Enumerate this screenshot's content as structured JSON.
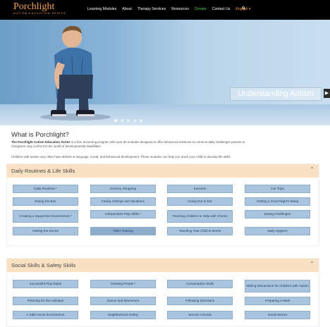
{
  "nav": {
    "logo": "Porchlight",
    "logo_sub": "AUTISM EDUCATION SERIES",
    "items": [
      "Learning Modules",
      "About",
      "Therapy Services",
      "Resources",
      "Donate",
      "Contact Us",
      "English ▾"
    ]
  },
  "hero": {
    "caption": "Understanding Autism",
    "next_glyph": "▶"
  },
  "intro": {
    "title": "What is Porchlight?",
    "bold": "The Porchlight Autism Education Series",
    "text": " is a free eLearning program with over 60 modules designed to offer behavioral solutions to common daily challenges parents or caregivers may confront in the world of developmental disabilities.",
    "text2": "Children with autism very often have deficits in language, social, and behavioral development. These modules can help you teach your child to develop life skills."
  },
  "sections": [
    {
      "title": "Daily Routines & Life Skills",
      "caret": "⌃",
      "buttons": [
        "Daily Routines *",
        "Grocery Shopping",
        "Exercise",
        "Car Trips",
        "Riding the Bus",
        "Family Outings and Vacations",
        "Going Out to Eat",
        "Getting a Good Night's Sleep",
        "Creating a Supportive Environment *",
        "Independent Play Skills *",
        "Teaching Children to Help with Chores",
        "Eating Challenges",
        "Visiting the Doctor",
        "Toilet Training",
        "Teaching Your Child to Dress",
        "Daily Hygiene"
      ]
    },
    {
      "title": "Social Skills & Safety Skills",
      "caret": "⌃",
      "buttons": [
        "Successful Play Dates",
        "Greeting People *",
        "Conversation Skills",
        "Sibling Interactions for Children with Autism",
        "Planning for the Holidays",
        "Dance and Movement",
        "Following Directions",
        "Preparing a Meal",
        "A Safe Home Environment",
        "Neighborhood Safety",
        "Service Animals",
        "Social Stories"
      ]
    }
  ]
}
